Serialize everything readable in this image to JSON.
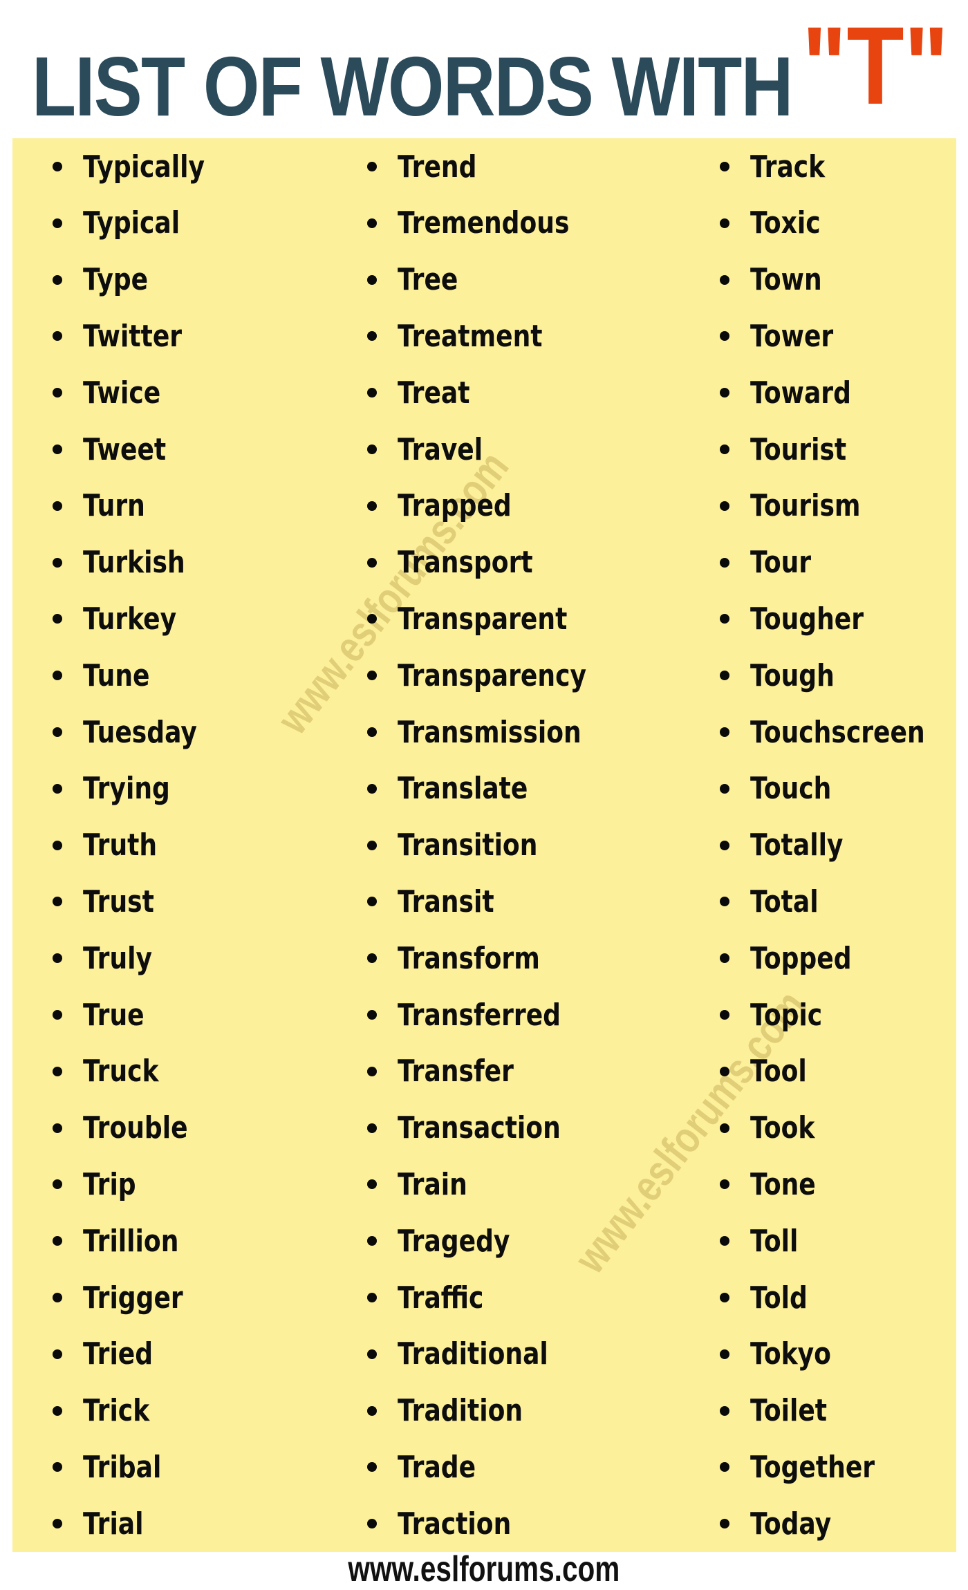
{
  "header": {
    "title": "LIST OF WORDS WITH",
    "letter": "\"T\"",
    "title_color": "#2b4a5a",
    "letter_color": "#e8440f"
  },
  "panel": {
    "background": "#fdf09a"
  },
  "columns": [
    {
      "items": [
        "Typically",
        "Typical",
        "Type",
        "Twitter",
        "Twice",
        "Tweet",
        "Turn",
        "Turkish",
        "Turkey",
        "Tune",
        "Tuesday",
        "Trying",
        "Truth",
        "Trust",
        "Truly",
        "True",
        "Truck",
        "Trouble",
        "Trip",
        "Trillion",
        "Trigger",
        "Tried",
        "Trick",
        "Tribal",
        "Trial"
      ]
    },
    {
      "items": [
        "Trend",
        "Tremendous",
        "Tree",
        "Treatment",
        "Treat",
        "Travel",
        "Trapped",
        "Transport",
        "Transparent",
        "Transparency",
        "Transmission",
        "Translate",
        "Transition",
        "Transit",
        "Transform",
        "Transferred",
        "Transfer",
        "Transaction",
        "Train",
        "Tragedy",
        "Traffic",
        "Traditional",
        "Tradition",
        "Trade",
        "Traction"
      ]
    },
    {
      "items": [
        "Track",
        "Toxic",
        "Town",
        "Tower",
        "Toward",
        "Tourist",
        "Tourism",
        "Tour",
        "Tougher",
        "Tough",
        "Touchscreen",
        "Touch",
        "Totally",
        "Total",
        "Topped",
        "Topic",
        "Tool",
        "Took",
        "Tone",
        "Toll",
        "Told",
        "Tokyo",
        "Toilet",
        "Together",
        "Today"
      ]
    }
  ],
  "watermark": "www.eslforums.com",
  "footer": {
    "url": "www.eslforums.com"
  }
}
